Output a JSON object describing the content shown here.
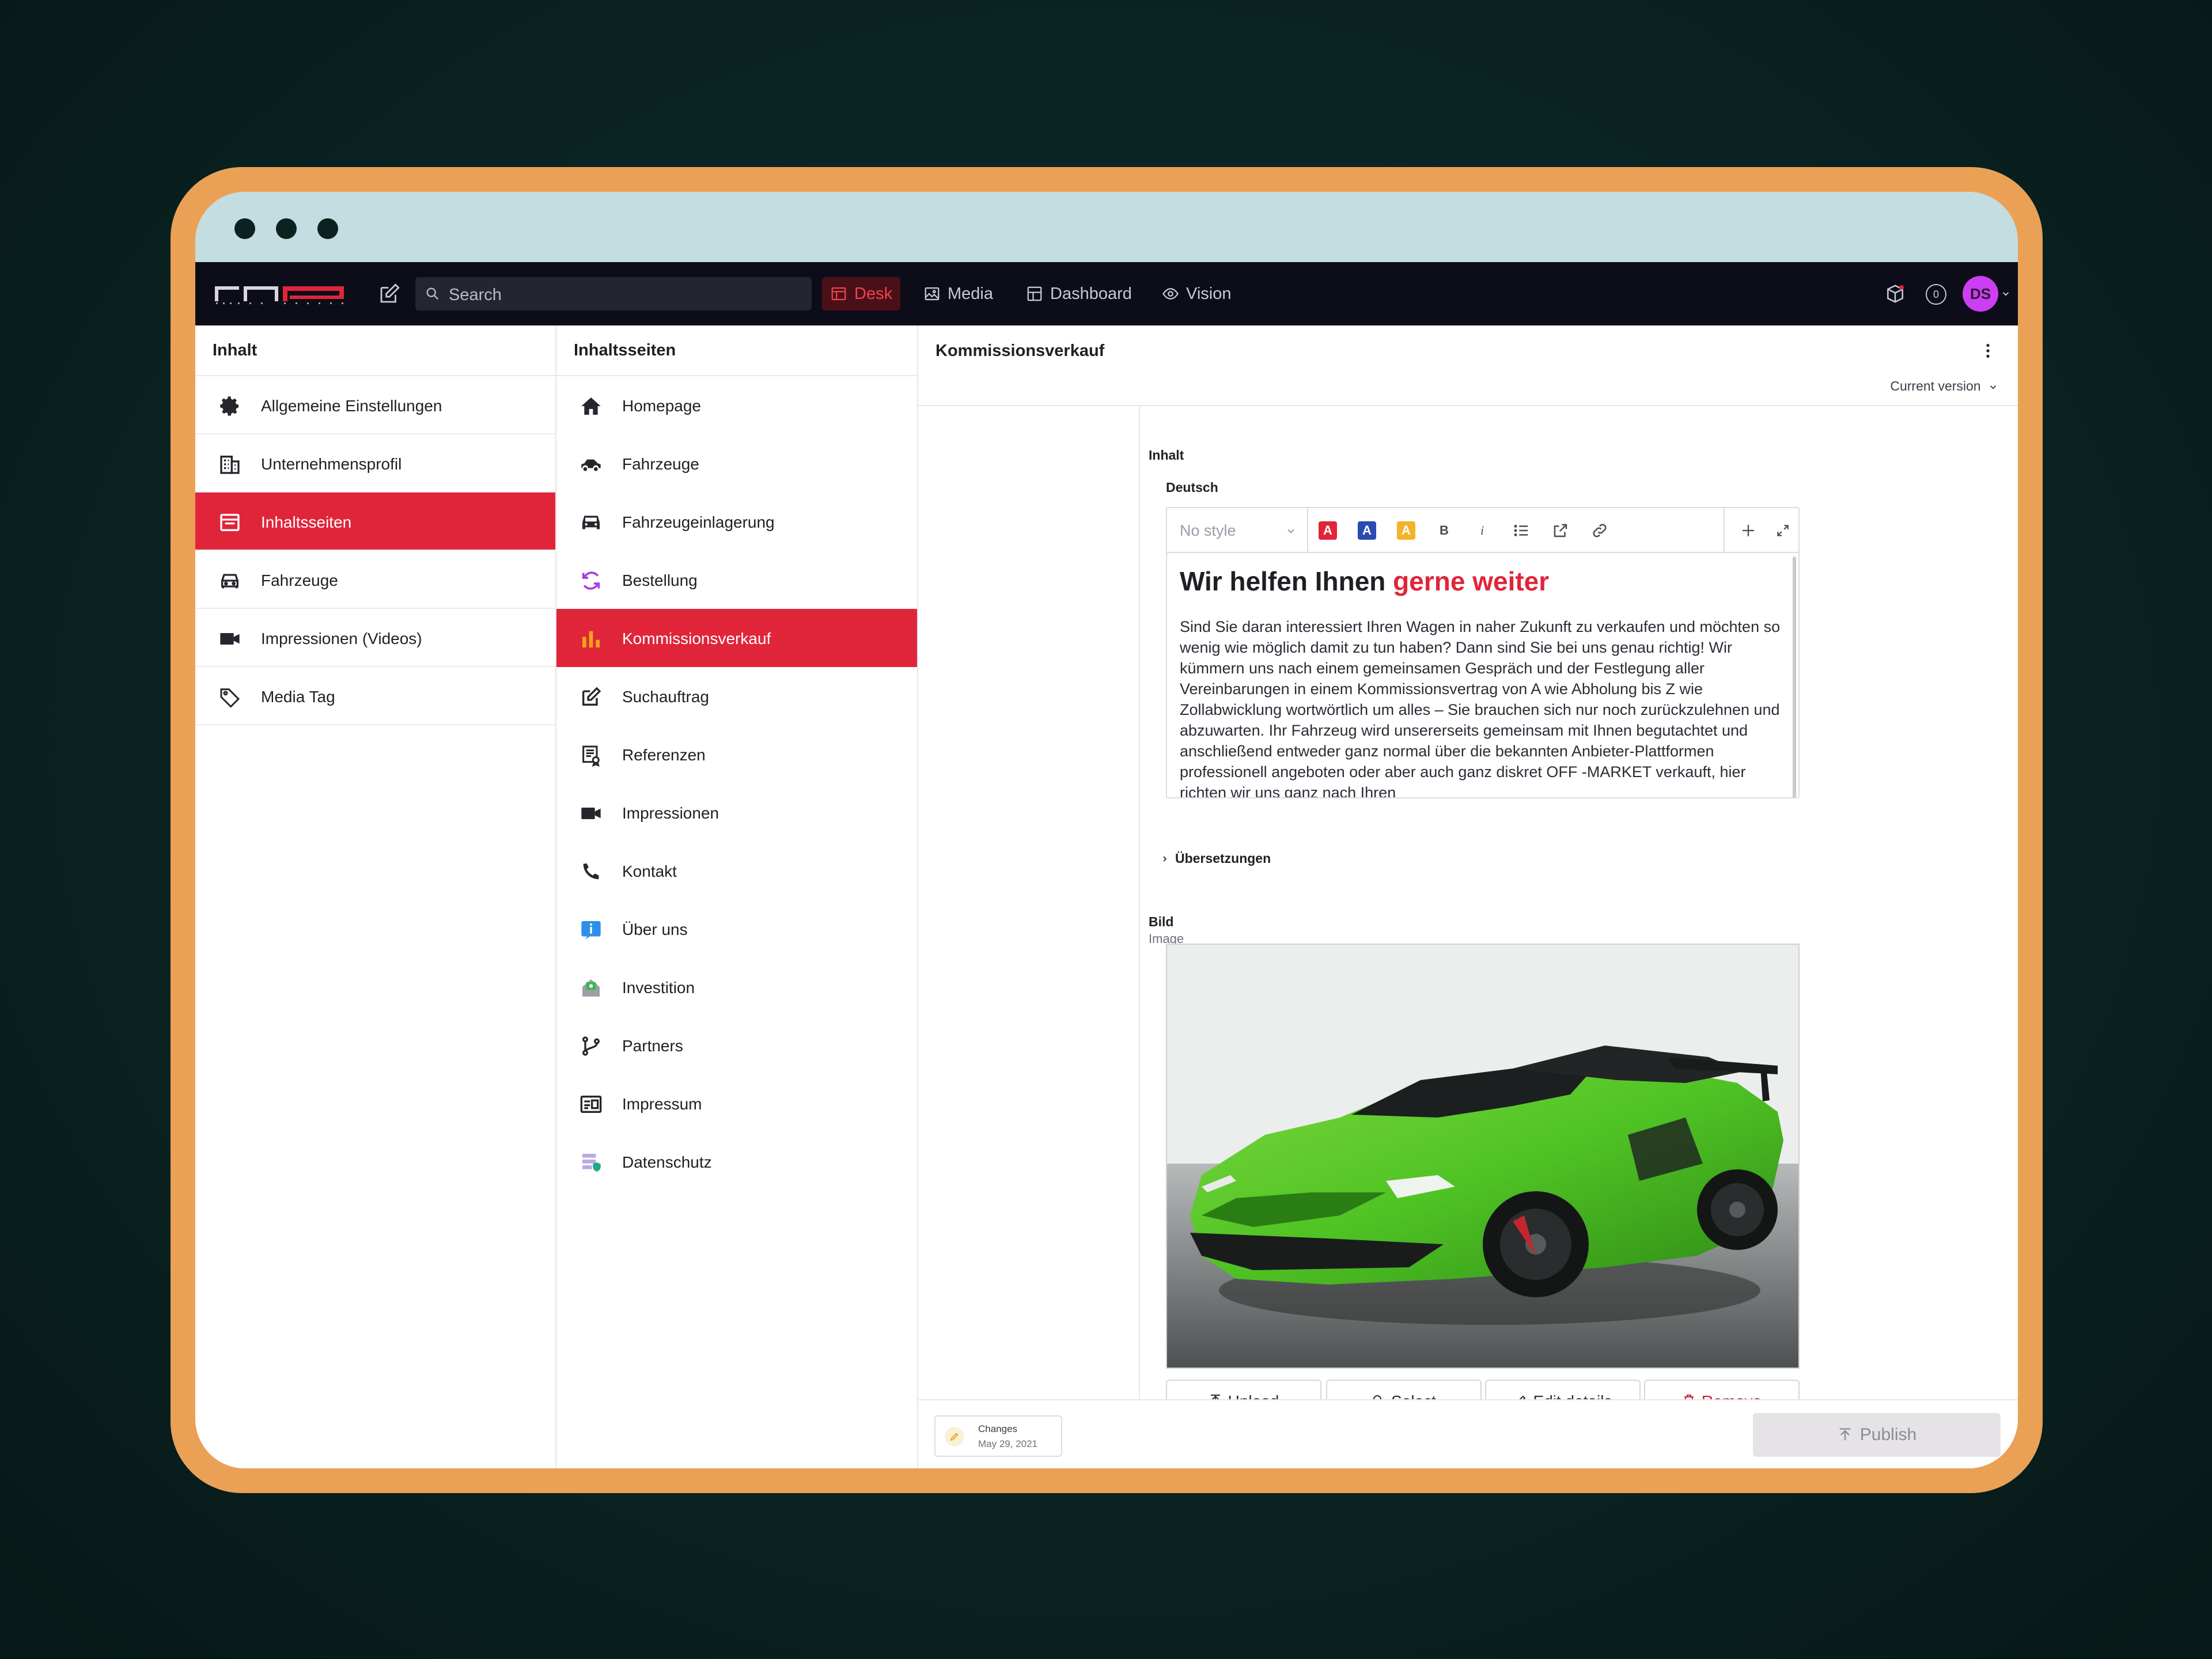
{
  "nav": {
    "search_placeholder": "Search",
    "items": [
      {
        "label": "Desk",
        "icon": "desk-icon",
        "active": true
      },
      {
        "label": "Media",
        "icon": "image-icon",
        "active": false
      },
      {
        "label": "Dashboard",
        "icon": "dashboard-icon",
        "active": false
      },
      {
        "label": "Vision",
        "icon": "eye-icon",
        "active": false
      }
    ],
    "notification_count": "0",
    "avatar_initials": "DS"
  },
  "pane1": {
    "title": "Inhalt",
    "items": [
      {
        "label": "Allgemeine Einstellungen",
        "icon": "gear-icon"
      },
      {
        "label": "Unternehmensprofil",
        "icon": "building-icon"
      },
      {
        "label": "Inhaltsseiten",
        "icon": "page-icon",
        "selected": true
      },
      {
        "label": "Fahrzeuge",
        "icon": "car-icon"
      },
      {
        "label": "Impressionen (Videos)",
        "icon": "video-icon"
      },
      {
        "label": "Media Tag",
        "icon": "tag-icon"
      }
    ]
  },
  "pane2": {
    "title": "Inhaltsseiten",
    "items": [
      {
        "label": "Homepage",
        "icon": "home-icon"
      },
      {
        "label": "Fahrzeuge",
        "icon": "car-icon"
      },
      {
        "label": "Fahrzeugeinlagerung",
        "icon": "car-front-icon"
      },
      {
        "label": "Bestellung",
        "icon": "refresh-icon"
      },
      {
        "label": "Kommissionsverkauf",
        "icon": "bar-chart-icon",
        "selected": true
      },
      {
        "label": "Suchauftrag",
        "icon": "edit-icon"
      },
      {
        "label": "Referenzen",
        "icon": "certificate-icon"
      },
      {
        "label": "Impressionen",
        "icon": "video-icon"
      },
      {
        "label": "Kontakt",
        "icon": "phone-icon"
      },
      {
        "label": "Über uns",
        "icon": "info-icon"
      },
      {
        "label": "Investition",
        "icon": "money-icon"
      },
      {
        "label": "Partners",
        "icon": "branch-icon"
      },
      {
        "label": "Impressum",
        "icon": "id-card-icon"
      },
      {
        "label": "Datenschutz",
        "icon": "shield-list-icon"
      }
    ]
  },
  "document": {
    "title": "Kommissionsverkauf",
    "version": "Current version",
    "field_inhalt": "Inhalt",
    "lang_label": "Deutsch",
    "style_select": "No style",
    "heading_plain": "Wir helfen Ihnen ",
    "heading_highlight": "gerne weiter",
    "body_text": "Sind Sie daran interessiert Ihren Wagen in naher Zukunft zu verkaufen und möchten so wenig wie möglich damit zu tun haben? Dann sind Sie bei uns genau richtig! Wir kümmern uns nach einem gemeinsamen Gespräch und der Festlegung aller Vereinbarungen in einem Kommissionsvertrag von A wie Abholung bis Z wie Zollabwicklung wortwörtlich um alles – Sie brauchen sich nur noch zurückzulehnen und abzuwarten. Ihr Fahrzeug wird unsererseits gemeinsam mit Ihnen begutachtet und anschließend entweder ganz normal über die bekannten Anbieter-Plattformen professionell angeboten oder aber auch ganz diskret OFF -MARKET verkauft, hier richten wir uns ganz nach Ihren",
    "translations": "Übersetzungen",
    "field_bild": "Bild",
    "field_bild_sub": "Image",
    "toolbar": {
      "bold": "B",
      "italic": "i",
      "color_a": "A"
    },
    "image_buttons": [
      "Upload",
      "Select",
      "Edit details",
      "Remove"
    ]
  },
  "footer": {
    "changes_label": "Changes",
    "changes_date": "May 29, 2021",
    "publish_label": "Publish"
  },
  "colors": {
    "accent": "#e0253a",
    "frame": "#eaa155",
    "titlebar": "#c3dde0",
    "topnav": "#0c0d18",
    "car_green": "#4fc324"
  }
}
